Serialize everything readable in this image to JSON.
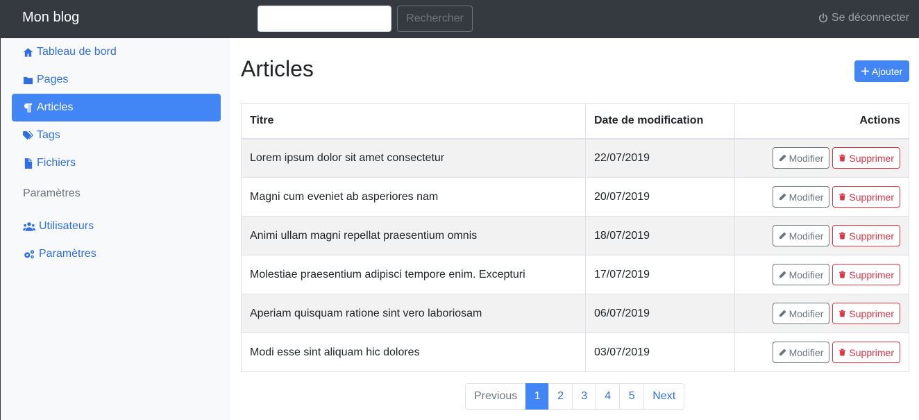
{
  "navbar": {
    "brand": "Mon blog",
    "search": {
      "value": "",
      "placeholder": ""
    },
    "search_button": "Rechercher",
    "logout": "Se déconnecter",
    "logout_icon": "power-icon"
  },
  "sidebar": {
    "items": [
      {
        "label": "Tableau de bord",
        "icon": "home-icon",
        "active": false
      },
      {
        "label": "Pages",
        "icon": "folder-icon",
        "active": false
      },
      {
        "label": "Articles",
        "icon": "paragraph-icon",
        "active": true
      },
      {
        "label": "Tags",
        "icon": "tags-icon",
        "active": false
      },
      {
        "label": "Fichiers",
        "icon": "file-icon",
        "active": false
      }
    ],
    "section_heading": "Paramètres",
    "settings_items": [
      {
        "label": "Utilisateurs",
        "icon": "users-icon"
      },
      {
        "label": "Paramètres",
        "icon": "cogs-icon"
      }
    ]
  },
  "main": {
    "title": "Articles",
    "add_button": "Ajouter",
    "table": {
      "headers": [
        "Titre",
        "Date de modification",
        "Actions"
      ],
      "rows": [
        {
          "title": "Lorem ipsum dolor sit amet consectetur",
          "date": "22/07/2019"
        },
        {
          "title": "Magni cum eveniet ab asperiores nam",
          "date": "20/07/2019"
        },
        {
          "title": "Animi ullam magni repellat praesentium omnis",
          "date": "18/07/2019"
        },
        {
          "title": "Molestiae praesentium adipisci tempore enim. Excepturi",
          "date": "17/07/2019"
        },
        {
          "title": "Aperiam quisquam ratione sint vero laboriosam",
          "date": "06/07/2019"
        },
        {
          "title": "Modi esse sint aliquam hic dolores",
          "date": "03/07/2019"
        }
      ],
      "edit_label": "Modifier",
      "delete_label": "Supprimer"
    },
    "pagination": {
      "previous": "Previous",
      "pages": [
        "1",
        "2",
        "3",
        "4",
        "5"
      ],
      "current": "1",
      "next": "Next"
    }
  },
  "colors": {
    "navbar": "#343a40",
    "accent": "#4285f4",
    "link": "#2f6fe0",
    "danger": "#dc3545",
    "secondary": "#6c757d"
  }
}
